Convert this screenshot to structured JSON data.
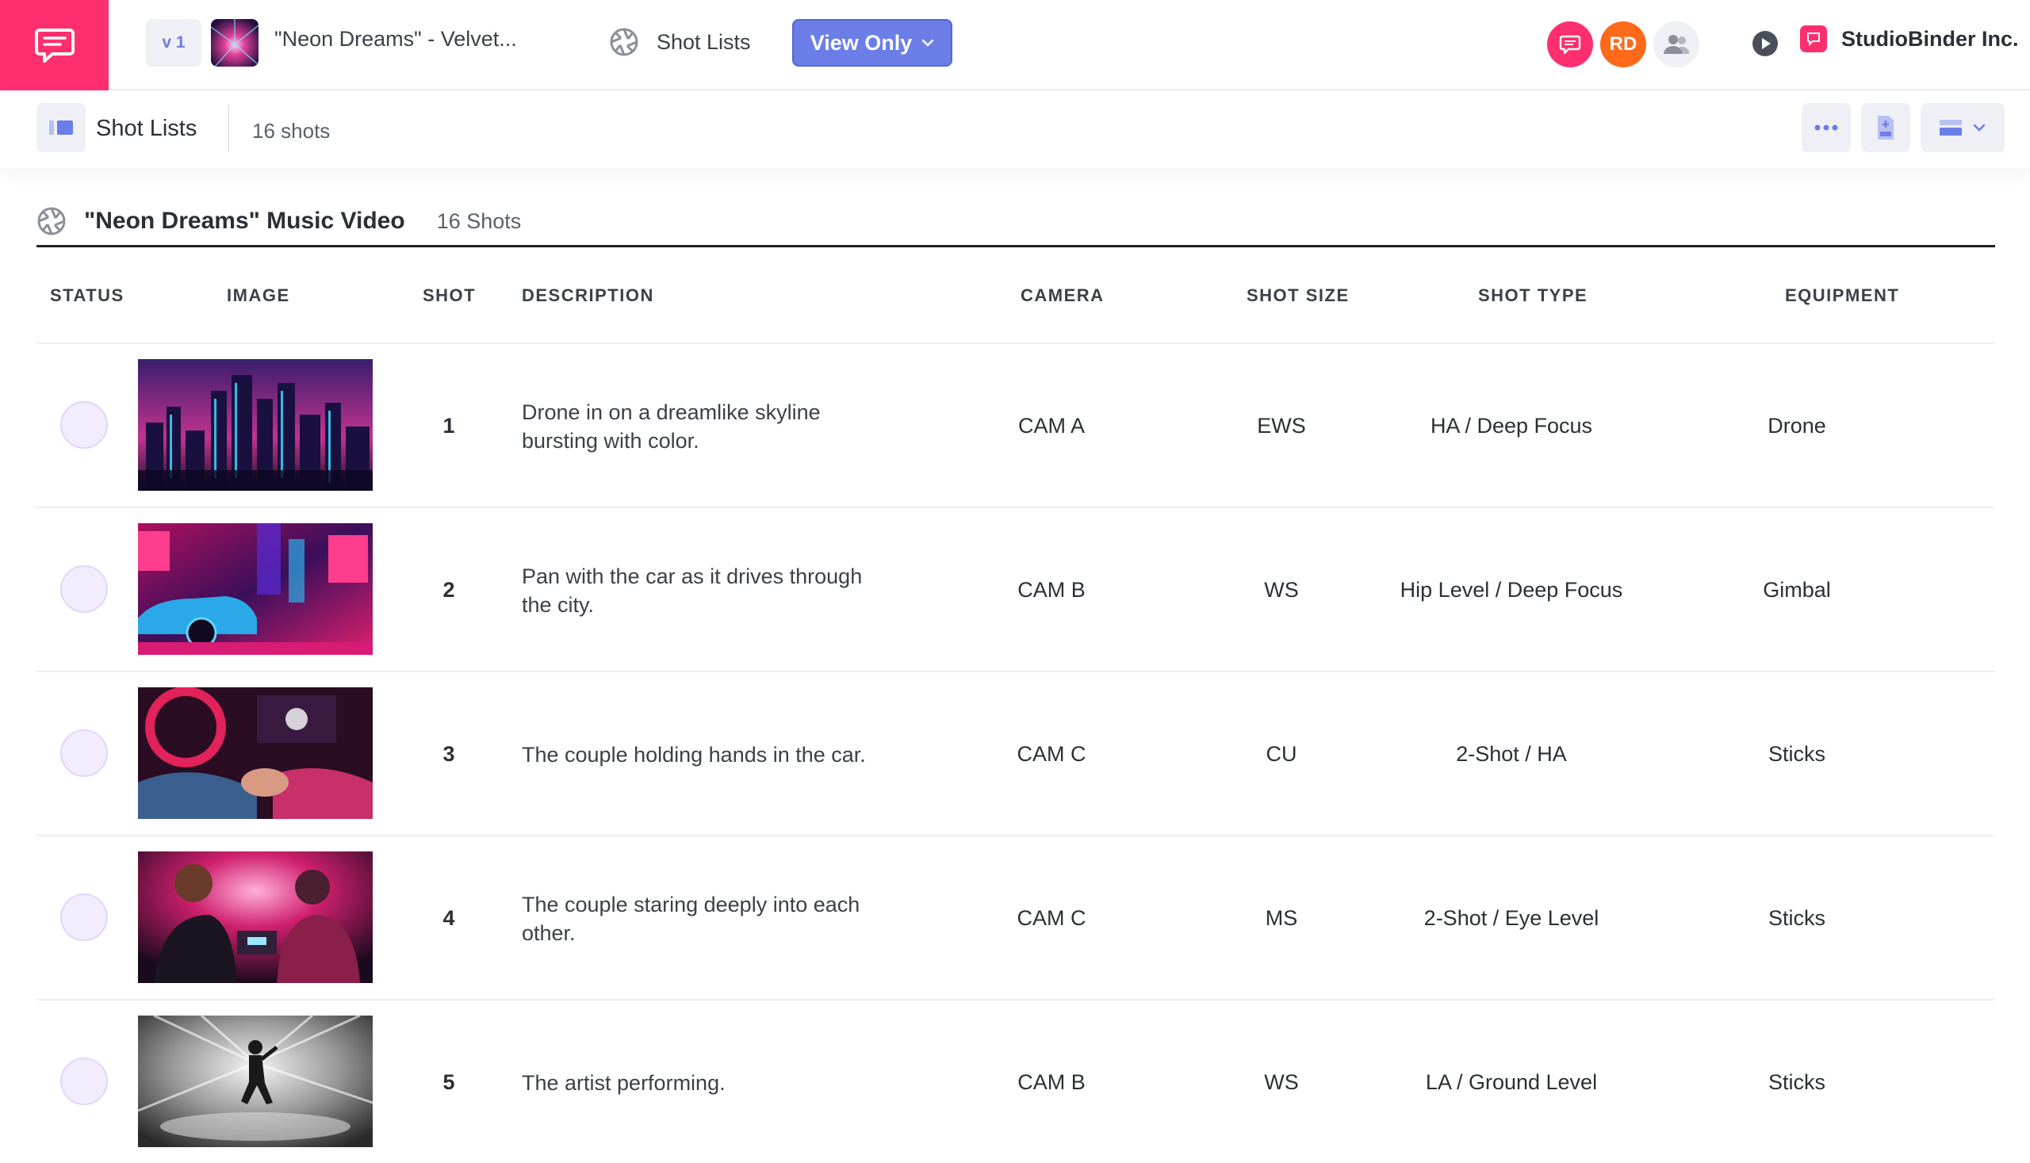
{
  "header": {
    "version": "v 1",
    "project_title": "\"Neon Dreams\" - Velvet...",
    "nav_label": "Shot Lists",
    "view_button": "View Only",
    "avatar_initials": "RD",
    "company": "StudioBinder Inc."
  },
  "subheader": {
    "title": "Shot Lists",
    "count": "16 shots"
  },
  "list": {
    "title": "\"Neon Dreams\" Music Video",
    "count": "16 Shots"
  },
  "columns": {
    "status": "STATUS",
    "image": "IMAGE",
    "shot": "SHOT",
    "description": "DESCRIPTION",
    "camera": "CAMERA",
    "shot_size": "SHOT SIZE",
    "shot_type": "SHOT TYPE",
    "equipment": "EQUIPMENT"
  },
  "rows": [
    {
      "shot": "1",
      "description": "Drone in on a dreamlike skyline bursting with color.",
      "camera": "CAM A",
      "shot_size": "EWS",
      "shot_type": "HA / Deep Focus",
      "equipment": "Drone"
    },
    {
      "shot": "2",
      "description": "Pan with the car as it drives through the city.",
      "camera": "CAM B",
      "shot_size": "WS",
      "shot_type": "Hip Level / Deep Focus",
      "equipment": "Gimbal"
    },
    {
      "shot": "3",
      "description": "The couple holding hands in the car.",
      "camera": "CAM C",
      "shot_size": "CU",
      "shot_type": "2-Shot / HA",
      "equipment": "Sticks"
    },
    {
      "shot": "4",
      "description": "The couple staring deeply into each other.",
      "camera": "CAM C",
      "shot_size": "MS",
      "shot_type": "2-Shot / Eye Level",
      "equipment": "Sticks"
    },
    {
      "shot": "5",
      "description": "The artist performing.",
      "camera": "CAM B",
      "shot_size": "WS",
      "shot_type": "LA / Ground Level",
      "equipment": "Sticks"
    }
  ],
  "colors": {
    "brand": "#ff2e6e",
    "accent": "#6b7ee8",
    "status_fill": "#f2ecfd"
  }
}
